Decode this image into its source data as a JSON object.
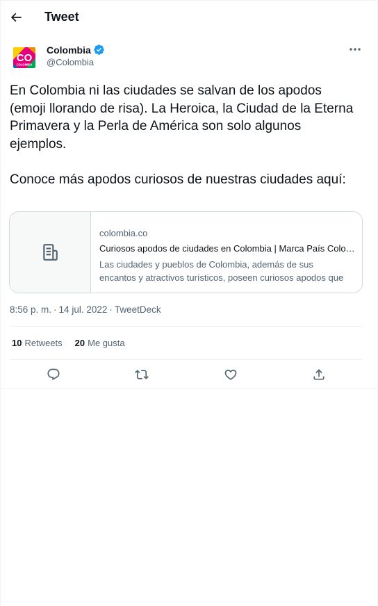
{
  "header": {
    "title": "Tweet",
    "back_icon": "arrow-left-icon"
  },
  "author": {
    "name": "Colombia",
    "handle": "@Colombia",
    "verified": true,
    "verified_color": "#1d9bf0",
    "avatar_text": "CO",
    "avatar_subtext": "COLOMBIA"
  },
  "tweet": {
    "paragraph1": "En Colombia ni las ciudades se salvan de los apodos (emoji llorando de risa). La Heroica, la Ciudad de la Eterna Primavera y la Perla de América son solo algunos ejemplos.",
    "paragraph2": "Conoce más apodos curiosos de nuestras ciudades aquí:"
  },
  "card": {
    "domain": "colombia.co",
    "title": "Curiosos apodos de ciudades en Colombia | Marca País Colombia",
    "description_line1": "Las ciudades y pueblos de Colombia, además de sus",
    "description_line2": "encantos y atractivos turísticos, poseen curiosos apodos que"
  },
  "meta": {
    "time": "8:56 p. m.",
    "separator1": "·",
    "date": "14 jul. 2022",
    "separator2": "·",
    "source": "TweetDeck"
  },
  "stats": {
    "retweets_count": "10",
    "retweets_label": "Retweets",
    "likes_count": "20",
    "likes_label": "Me gusta"
  },
  "actions": {
    "reply_icon": "reply-icon",
    "retweet_icon": "retweet-icon",
    "like_icon": "heart-icon",
    "share_icon": "share-icon"
  },
  "colors": {
    "text": "#0f1419",
    "secondary": "#536471",
    "border": "#cfd9de",
    "divider": "#eff3f4",
    "card_thumb_bg": "#f7f9f9"
  }
}
